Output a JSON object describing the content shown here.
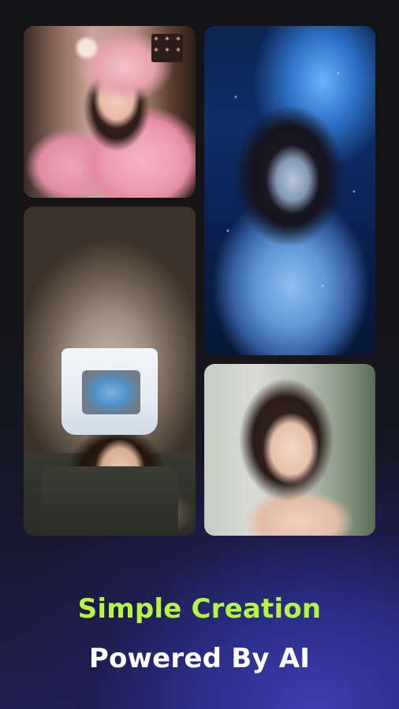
{
  "gallery": {
    "images": [
      {
        "subject": "woman-pink-coat-cafe"
      },
      {
        "subject": "girl-blue-water-art"
      },
      {
        "subject": "woman-crop-top"
      },
      {
        "subject": "woman-portrait"
      }
    ]
  },
  "promo": {
    "headline_1": "Simple Creation",
    "headline_2": "Powered By AI"
  },
  "colors": {
    "accent": "#B6F542",
    "text": "#FFFFFF",
    "background_top": "#141416",
    "background_glow": "#3B3FB0"
  }
}
